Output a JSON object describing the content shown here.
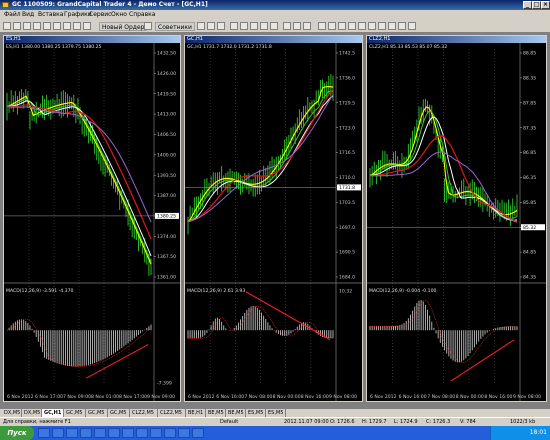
{
  "window": {
    "title": "GC 1100509: GrandCapital Trader 4 - Демо Счет - [GC,H1]"
  },
  "menu": [
    "Файл",
    "Вид",
    "Вставка",
    "Графики",
    "Сервис",
    "Окно",
    "Справка"
  ],
  "toolbar": {
    "new_order": "Новый Ордер",
    "advisors": "Советники"
  },
  "charts": [
    {
      "symbol_tab": "ES,H1",
      "header": "ES,H1",
      "ohlc": "1380.00 1380.25 1379.75 1380.25",
      "price_ticks": [
        "1432.50",
        "1426.00",
        "1419.50",
        "1413.00",
        "1406.50",
        "1400.00",
        "1393.50",
        "1387.00",
        "1380.25",
        "1374.00",
        "1367.50",
        "1361.00"
      ],
      "current_price": "1380.25",
      "macd_label": "MACD(12,26,9) -3.591 -4.370",
      "macd_ticks": [
        "",
        "",
        "-7.399"
      ],
      "time_ticks": [
        "6 Nov 2012",
        "6 Nov 17:00",
        "7 Nov 09:00",
        "8 Nov 01:00",
        "8 Nov 17:00",
        "9 Nov 09:00"
      ]
    },
    {
      "symbol_tab": "GC,H1",
      "header": "GC,H1",
      "ohlc": "1731.7 1732.0 1731.2 1731.8",
      "price_ticks": [
        "1742.5",
        "1736.0",
        "1729.5",
        "1723.0",
        "1716.5",
        "1710.0",
        "1703.5",
        "1697.0",
        "1690.5",
        "1684.0"
      ],
      "current_price": "1731.8",
      "macd_label": "MACD(12,26,9) 2.61 3.93",
      "macd_ticks": [
        "10.32",
        "",
        ""
      ],
      "time_ticks": [
        "6 Nov 2012",
        "6 Nov 16:00",
        "7 Nov 08:00",
        "8 Nov 00:00",
        "8 Nov 16:00",
        "9 Nov 08:00"
      ]
    },
    {
      "symbol_tab": "CLZ2,H1",
      "header": "CLZ2,H1",
      "ohlc": "85.33 85.53 85.07 85.32",
      "price_ticks": [
        "88.85",
        "88.35",
        "87.85",
        "87.35",
        "86.85",
        "86.35",
        "85.85",
        "85.32",
        "84.85",
        "84.35"
      ],
      "current_price": "85.32",
      "macd_label": "MACD(12,26,9) -0.004 -0.100",
      "macd_ticks": [
        "",
        "",
        ""
      ],
      "time_ticks": [
        "6 Nov 2012",
        "6 Nov 16:00",
        "7 Nov 08:00",
        "8 Nov 00:00",
        "8 Nov 16:00",
        "9 Nov 08:00"
      ]
    }
  ],
  "tabs": [
    "DX,M5",
    "DX,M5",
    "GC,H1",
    "GC,M5",
    "GC,M5",
    "GC,M5",
    "CLZ2,M5",
    "CLZ2,M5",
    "BE,H1",
    "BE,M5",
    "BE,M5",
    "ES,M5",
    "ES,M5"
  ],
  "status": {
    "help": "Для справки, нажмите F1",
    "profile": "Default",
    "datetime": "2012.11.07 09:00",
    "open": "O: 1726.6",
    "high": "H: 1729.7",
    "low": "L: 1724.9",
    "close": "C: 1726.3",
    "volume": "V: 784",
    "traffic": "1022/3 kb"
  },
  "taskbar": {
    "start": "Пуск",
    "clock": "18:01"
  },
  "colors": {
    "candle": "#2ecc2e",
    "ma_fast": "#ffff00",
    "ma_mid": "#ffffff",
    "ma_slow_red": "#e01818",
    "ma_slowest": "#9966cc",
    "macd_bar": "#c0c0c0",
    "macd_signal": "#ff3030",
    "trendline": "#ff2020"
  }
}
